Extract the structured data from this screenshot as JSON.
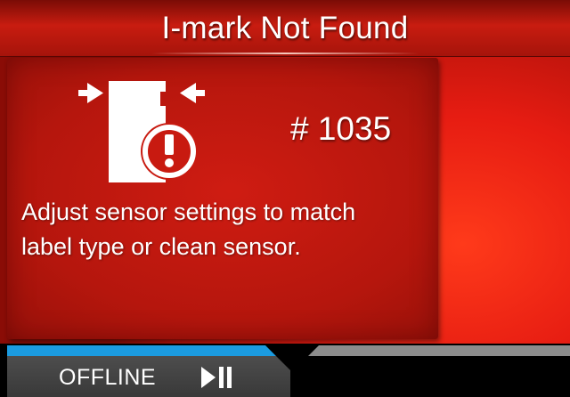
{
  "header": {
    "title": "I-mark Not Found"
  },
  "error": {
    "code": "# 1035",
    "message_lines": [
      "Adjust sensor settings to match",
      "label type or clean sensor."
    ],
    "icon": "sensor-error-icon"
  },
  "status_bar": {
    "status": "OFFLINE",
    "play_pause_icon": "play-pause-icon",
    "progress": 0.48
  },
  "colors": {
    "title_bar": "#a6140b",
    "panel": "#b5160d",
    "background_accent": "#e61c12",
    "progress": "#1b9be0",
    "status_tab": "#3f3f3f",
    "text": "#ffffff"
  }
}
